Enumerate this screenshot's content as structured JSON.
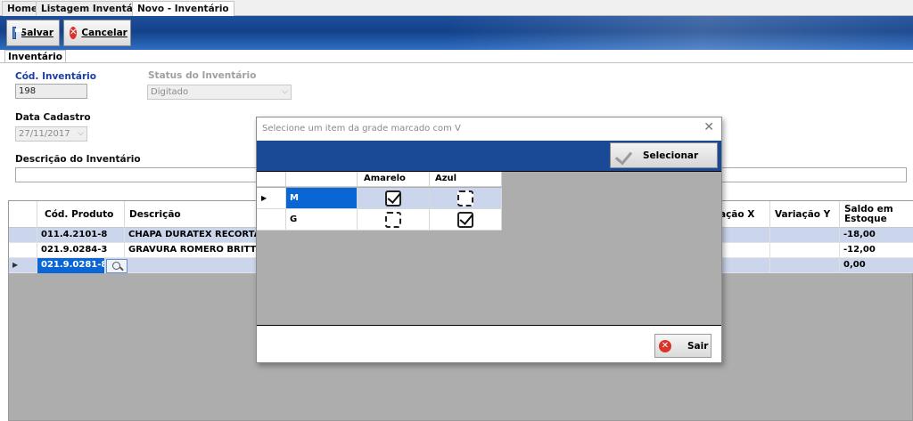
{
  "top_tabs": [
    {
      "label": "Home"
    },
    {
      "label": "Listagem Inventário"
    },
    {
      "label": "Novo - Inventário"
    }
  ],
  "toolbar": {
    "save_label": "Salvar",
    "cancel_label": "Cancelar"
  },
  "sub_tab": {
    "label": "Inventário"
  },
  "form": {
    "cod_label": "Cód. Inventário",
    "cod_value": "198",
    "status_label": "Status do Inventário",
    "status_value": "Digitado",
    "data_label": "Data Cadastro",
    "data_value": "27/11/2017",
    "descricao_label": "Descrição do Inventário",
    "descricao_value": ""
  },
  "grid": {
    "headers": {
      "cod_produto": "Cód. Produto",
      "descricao": "Descrição",
      "variacao_x": "ação X",
      "variacao_y": "Variação Y",
      "saldo": "Saldo em Estoque"
    },
    "rows": [
      {
        "cod": "011.4.2101-8",
        "descricao": "CHAPA DURATEX RECORTADO",
        "saldo": "-18,00"
      },
      {
        "cod": "021.9.0284-3",
        "descricao": "GRAVURA ROMERO BRITTO -",
        "saldo": "-12,00"
      },
      {
        "cod": "021.9.0281-8",
        "descricao": "",
        "saldo": "0,00"
      }
    ]
  },
  "dialog": {
    "title": "Selecione um item da grade marcado com V",
    "select_label": "Selecionar",
    "exit_label": "Sair",
    "columns": [
      "Amarelo",
      "Azul"
    ],
    "rows": [
      {
        "label": "M",
        "amarelo": true,
        "azul": false
      },
      {
        "label": "G",
        "amarelo": false,
        "azul": true
      }
    ]
  },
  "colors": {
    "toolbar_blue": "#1e4f9c",
    "selection_blue": "#0a66d4",
    "row_tint": "#cbd6ec",
    "label_blue": "#1a3ea8"
  }
}
